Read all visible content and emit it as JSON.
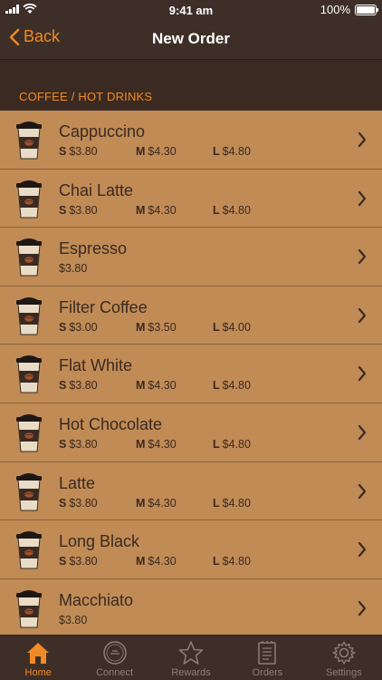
{
  "status_bar": {
    "time": "9:41 am",
    "battery": "100%"
  },
  "nav": {
    "back_label": "Back",
    "title": "New Order"
  },
  "section": {
    "title": "COFFEE / HOT DRINKS"
  },
  "menu_items": [
    {
      "name": "Cappuccino",
      "s": "$3.80",
      "m": "$4.30",
      "l": "$4.80"
    },
    {
      "name": "Chai Latte",
      "s": "$3.80",
      "m": "$4.30",
      "l": "$4.80"
    },
    {
      "name": "Espresso",
      "single": "$3.80"
    },
    {
      "name": "Filter Coffee",
      "s": "$3.00",
      "m": "$3.50",
      "l": "$4.00"
    },
    {
      "name": "Flat White",
      "s": "$3.80",
      "m": "$4.30",
      "l": "$4.80"
    },
    {
      "name": "Hot Chocolate",
      "s": "$3.80",
      "m": "$4.30",
      "l": "$4.80"
    },
    {
      "name": "Latte",
      "s": "$3.80",
      "m": "$4.30",
      "l": "$4.80"
    },
    {
      "name": "Long Black",
      "s": "$3.80",
      "m": "$4.30",
      "l": "$4.80"
    },
    {
      "name": "Macchiato",
      "single": "$3.80"
    }
  ],
  "size_labels": {
    "s": "S",
    "m": "M",
    "l": "L"
  },
  "tabs": [
    {
      "label": "Home",
      "icon": "home-icon",
      "active": true
    },
    {
      "label": "Connect",
      "icon": "connect-icon",
      "active": false
    },
    {
      "label": "Rewards",
      "icon": "star-icon",
      "active": false
    },
    {
      "label": "Orders",
      "icon": "orders-icon",
      "active": false
    },
    {
      "label": "Settings",
      "icon": "gear-icon",
      "active": false
    }
  ],
  "colors": {
    "accent": "#f08a24",
    "row_bg": "#c08b55",
    "bar_bg": "#3d2f28"
  }
}
